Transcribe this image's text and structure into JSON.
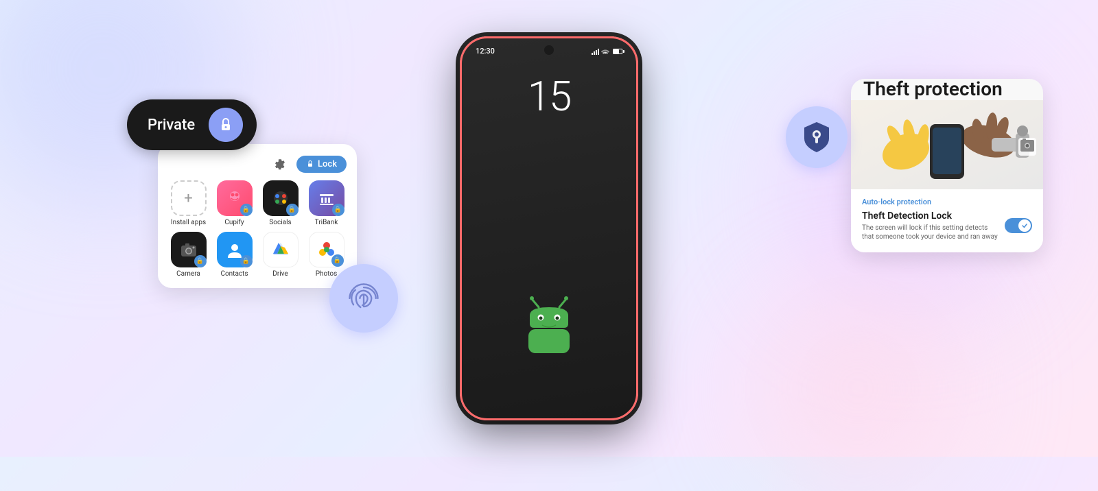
{
  "background": {
    "gradient_desc": "light lavender to pink gradient with blobs"
  },
  "phone": {
    "time": "12:30",
    "date": "15",
    "border_color": "#ff6b6b"
  },
  "private_card": {
    "label": "Private",
    "lock_icon": "🔒"
  },
  "app_grid": {
    "lock_button": "Lock",
    "apps": [
      {
        "name": "Install apps",
        "type": "install"
      },
      {
        "name": "Cupify",
        "type": "cupify"
      },
      {
        "name": "Socials",
        "type": "socials"
      },
      {
        "name": "TriBank",
        "type": "tribank"
      },
      {
        "name": "Camera",
        "type": "camera"
      },
      {
        "name": "Contacts",
        "type": "contacts"
      },
      {
        "name": "Drive",
        "type": "drive"
      },
      {
        "name": "Photos",
        "type": "photos"
      }
    ]
  },
  "theft_card": {
    "title": "Theft protection",
    "auto_lock_label": "Auto-lock protection",
    "detection_lock_title": "Theft Detection Lock",
    "detection_lock_desc": "The screen will lock if this setting detects that someone took your device and ran away",
    "toggle_enabled": true
  }
}
